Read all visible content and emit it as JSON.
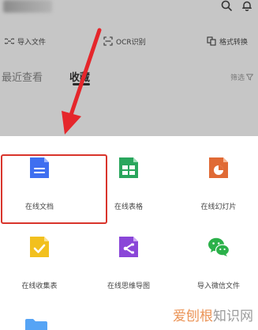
{
  "header": {
    "user_name_blurred": "",
    "icons": [
      "search-icon",
      "bell-icon"
    ]
  },
  "quick_actions": {
    "import_file": "导入文件",
    "ocr": "OCR识别",
    "format_convert": "格式转换"
  },
  "tabs": {
    "recent": "最近查看",
    "favorites": "收藏",
    "filter": "筛选"
  },
  "create_menu": {
    "items": [
      {
        "label": "在线文档",
        "icon": "doc-icon",
        "color": "#3f6ff0"
      },
      {
        "label": "在线表格",
        "icon": "sheet-icon",
        "color": "#2aa65d"
      },
      {
        "label": "在线幻灯片",
        "icon": "slide-icon",
        "color": "#e06a35"
      },
      {
        "label": "在线收集表",
        "icon": "form-icon",
        "color": "#f2c01e"
      },
      {
        "label": "在线思维导图",
        "icon": "mindmap-icon",
        "color": "#8a46d8"
      },
      {
        "label": "导入微信文件",
        "icon": "wechat-icon",
        "color": "#2bb14a"
      }
    ]
  },
  "annotation": {
    "highlight_color": "#d9342b",
    "arrow_color": "#e5262b"
  },
  "watermark": {
    "part1": "爱刨根",
    "part2": "知识网"
  }
}
